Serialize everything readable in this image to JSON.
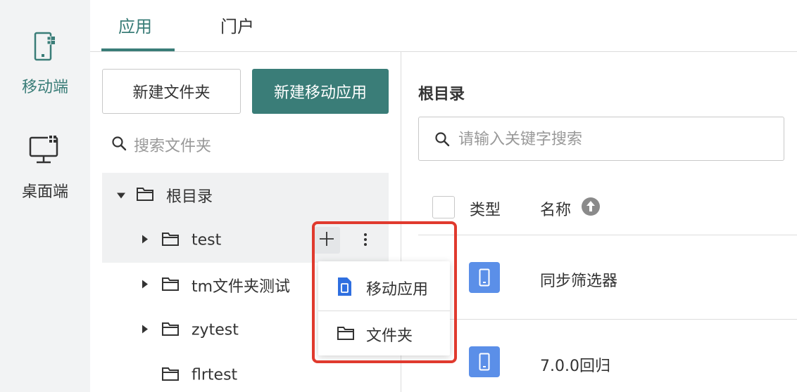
{
  "sidebar": {
    "items": [
      {
        "label": "移动端",
        "icon": "mobile-icon",
        "active": true
      },
      {
        "label": "桌面端",
        "icon": "desktop-icon",
        "active": false
      }
    ]
  },
  "tabs": [
    {
      "label": "应用",
      "active": true
    },
    {
      "label": "门户",
      "active": false
    }
  ],
  "left_pane": {
    "new_folder_label": "新建文件夹",
    "new_app_label": "新建移动应用",
    "search_placeholder": "搜索文件夹",
    "tree": [
      {
        "label": "根目录",
        "expanded": true
      },
      {
        "label": "test",
        "expanded": false
      },
      {
        "label": "tm文件夹测试",
        "expanded": false
      },
      {
        "label": "zytest",
        "expanded": false
      },
      {
        "label": "flrtest",
        "expanded": false
      }
    ]
  },
  "context_menu": {
    "items": [
      {
        "label": "移动应用",
        "icon": "mobile-app-icon"
      },
      {
        "label": "文件夹",
        "icon": "folder-icon"
      }
    ]
  },
  "right_pane": {
    "title": "根目录",
    "search_placeholder": "请输入关键字搜索",
    "columns": {
      "type": "类型",
      "name": "名称"
    },
    "rows": [
      {
        "type_icon": "mobile-app-icon",
        "name": "同步筛选器"
      },
      {
        "type_icon": "mobile-app-icon",
        "name": "7.0.0回归"
      }
    ]
  },
  "colors": {
    "accent": "#3a7d78",
    "app_icon_bg": "#5b8fe8",
    "highlight_border": "#e03a2e"
  }
}
